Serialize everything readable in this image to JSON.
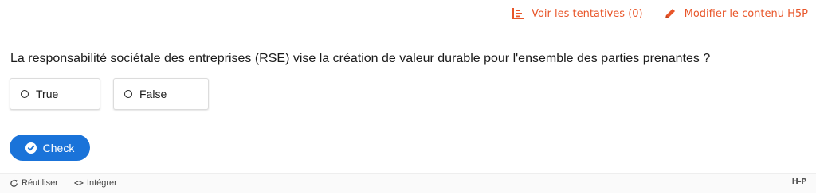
{
  "top_actions": {
    "attempts_label": "Voir les tentatives (0)",
    "edit_label": "Modifier le contenu H5P"
  },
  "question": {
    "text": "La responsabilité sociétale des entreprises (RSE) vise la création de valeur durable pour l'ensemble des parties prenantes ?"
  },
  "answers": [
    {
      "label": "True"
    },
    {
      "label": "False"
    }
  ],
  "check_button": {
    "label": "Check"
  },
  "footer": {
    "reuse_label": "Réutiliser",
    "embed_label": "Intégrer",
    "embed_glyph": "<>",
    "logo": "H-P"
  },
  "colors": {
    "accent": "#e8562a",
    "primary_button": "#1a73d9"
  },
  "icons": {
    "attempts": "bar-chart-icon",
    "edit": "pencil-icon",
    "check": "check-circle-icon",
    "reuse": "refresh-icon",
    "embed": "code-icon"
  }
}
